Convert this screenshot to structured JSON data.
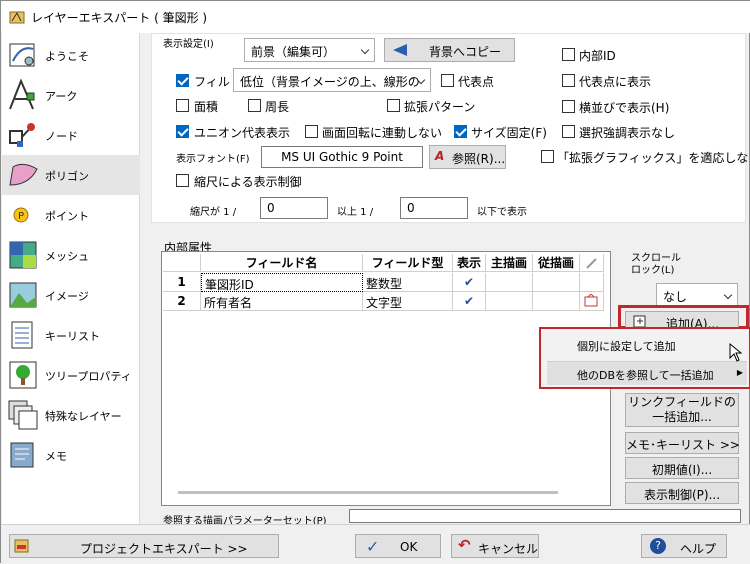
{
  "window": {
    "title": "レイヤーエキスパート ( 筆図形 )"
  },
  "sidebar": {
    "items": [
      {
        "label": "ようこそ"
      },
      {
        "label": "アーク"
      },
      {
        "label": "ノード"
      },
      {
        "label": "ポリゴン"
      },
      {
        "label": "ポイント"
      },
      {
        "label": "メッシュ"
      },
      {
        "label": "イメージ"
      },
      {
        "label": "キーリスト"
      },
      {
        "label": "ツリープロパティ"
      },
      {
        "label": "特殊なレイヤー"
      },
      {
        "label": "メモ"
      }
    ]
  },
  "display": {
    "group_label": "表示設定(I)",
    "layer_combo": "前景（編集可）",
    "copy_bg_btn": "背景へコピー",
    "fill_label": "フィル",
    "fill_checked": true,
    "fill_combo": "低位（背景イメージの上、線形の",
    "rep_point_label": "代表点",
    "area_label": "面積",
    "perimeter_label": "周長",
    "ext_pattern_label": "拡張パターン",
    "union_label": "ユニオン代表表示",
    "union_checked": true,
    "rot_label": "画面回転に連動しない",
    "size_fixed_label": "サイズ固定(F)",
    "size_fixed_checked": true,
    "font_label": "表示フォント(F)",
    "font_value": "MS UI Gothic 9 Point",
    "ref_btn": "参照(R)...",
    "scale_ctrl_label": "縮尺による表示制御",
    "scale_from_label": "縮尺が 1 /",
    "scale_from_value": "0",
    "above_label": "以上 1 /",
    "scale_to_value": "0",
    "below_label": "以下で表示",
    "inner_id_label": "内部ID",
    "show_rep_label": "代表点に表示",
    "horizontal_label": "横並びで表示(H)",
    "no_select_hl_label": "選択強調表示なし",
    "ext_graphics_label": "「拡張グラフィックス」を適応しない"
  },
  "attrs": {
    "group_label": "内部属性",
    "columns": [
      "フィールド名",
      "フィールド型",
      "表示",
      "主描画",
      "従描画"
    ],
    "rows": [
      {
        "no": "1",
        "name": "筆図形ID",
        "type": "整数型",
        "show": "✔"
      },
      {
        "no": "2",
        "name": "所有者名",
        "type": "文字型",
        "show": "✔"
      }
    ]
  },
  "right": {
    "scroll_lock_label": "スクロール\nロック(L)",
    "scroll_lock_value": "なし",
    "add_btn": "追加(A)...",
    "link_btn_line1": "リンクフィールドの",
    "link_btn_line2": "一括追加...",
    "memo_btn": "メモ･キーリスト >>",
    "init_btn": "初期値(I)...",
    "display_ctrl_btn": "表示制御(P)..."
  },
  "menu": {
    "items": [
      {
        "label": "個別に設定して追加"
      },
      {
        "label": "他のDBを参照して一括追加"
      }
    ]
  },
  "param_label": "参照する描画パラメーターセット(P)",
  "footer": {
    "project_btn": "プロジェクトエキスパート >>",
    "ok_btn": "OK",
    "cancel_btn": "キャンセル",
    "help_btn": "ヘルプ"
  }
}
